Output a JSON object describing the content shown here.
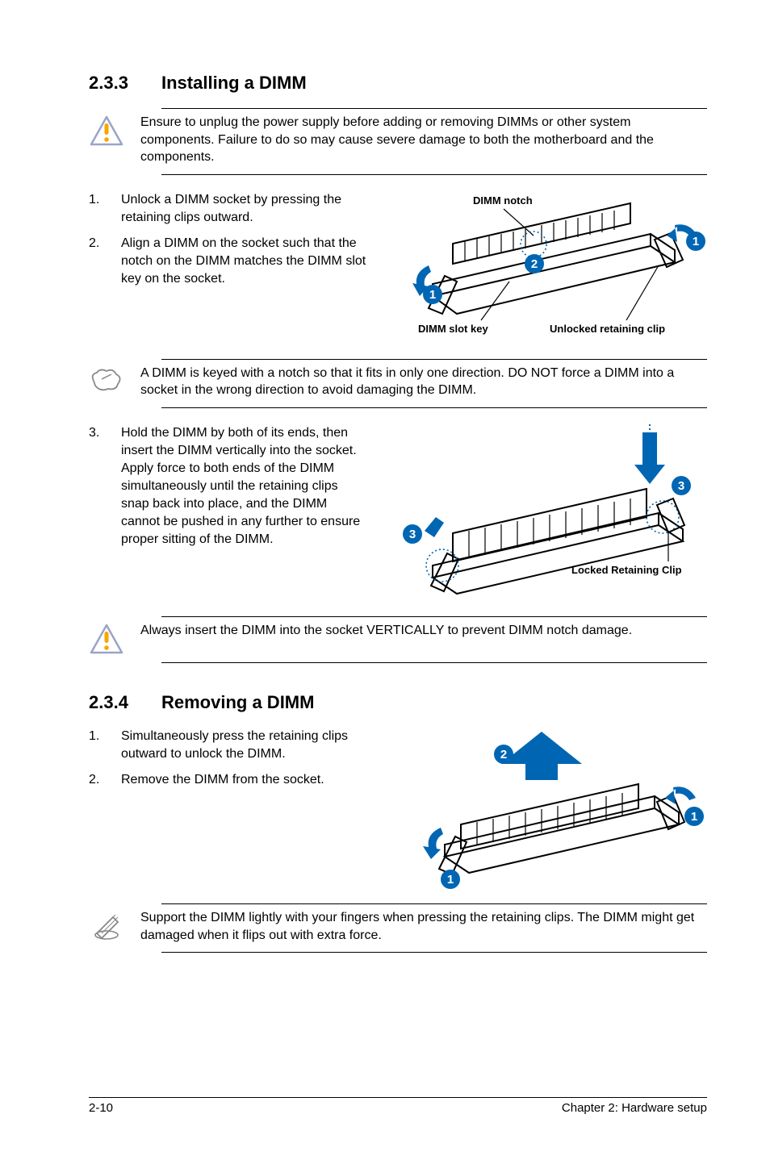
{
  "section233": {
    "number": "2.3.3",
    "title": "Installing a DIMM",
    "warning1": "Ensure to unplug the power supply before adding or removing DIMMs or other system components. Failure to do so may cause severe damage to both the motherboard and the components.",
    "step1_idx": "1.",
    "step1": "Unlock a DIMM socket by pressing the retaining clips outward.",
    "step2_idx": "2.",
    "step2": "Align a DIMM on the socket such that the notch on the DIMM matches the DIMM slot key on the socket.",
    "fig1": {
      "notch": "DIMM notch",
      "c1": "1",
      "c2": "2",
      "c1b": "1",
      "slotkey": "DIMM slot key",
      "unlocked": "Unlocked retaining clip"
    },
    "note1": "A DIMM is keyed with a notch so that it fits in only one direction. DO NOT force a DIMM into a socket in the wrong direction to avoid damaging the DIMM.",
    "step3_idx": "3.",
    "step3": "Hold the DIMM by both of its ends, then insert the DIMM vertically into the socket. Apply force to both ends of the DIMM simultaneously until the retaining clips snap back into place, and the DIMM cannot be pushed in any further to ensure proper sitting of the DIMM.",
    "fig2": {
      "c3a": "3",
      "c3b": "3",
      "locked": "Locked Retaining Clip"
    },
    "warning2": "Always insert the DIMM into the socket VERTICALLY to prevent DIMM notch damage."
  },
  "section234": {
    "number": "2.3.4",
    "title": "Removing a DIMM",
    "step1_idx": "1.",
    "step1": "Simultaneously press the retaining clips outward to unlock the DIMM.",
    "step2_idx": "2.",
    "step2": "Remove the DIMM from the socket.",
    "fig3": {
      "c1": "1",
      "c1b": "1",
      "c2": "2"
    },
    "note_pencil": "Support the DIMM lightly with your fingers when pressing the retaining clips. The DIMM might get damaged when it flips out with extra force."
  },
  "footer": {
    "page": "2-10",
    "chapter": "Chapter 2:  Hardware setup"
  }
}
